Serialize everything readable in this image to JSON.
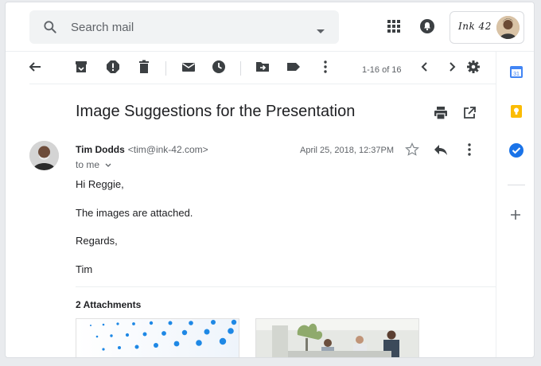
{
  "search": {
    "placeholder": "Search mail"
  },
  "account": {
    "brand": "Ink 42"
  },
  "toolbar": {
    "pager": "1-16 of 16"
  },
  "message": {
    "subject": "Image Suggestions for the Presentation",
    "sender_name": "Tim Dodds",
    "sender_email": "<tim@ink-42.com>",
    "to": "to me",
    "date": "April 25, 2018, 12:37PM",
    "lines": [
      "Hi Reggie,",
      "The images are attached.",
      "Regards,",
      "Tim"
    ]
  },
  "attachments": {
    "title": "2 Attachments"
  },
  "colors": {
    "accent_blue": "#1a73e8",
    "calendar_blue": "#4285f4",
    "keep_yellow": "#fbbc04"
  }
}
